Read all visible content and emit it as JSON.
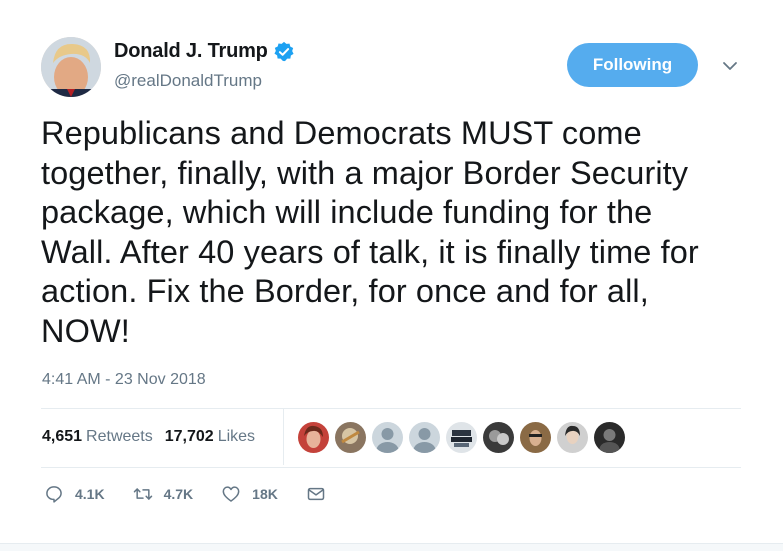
{
  "author": {
    "display_name": "Donald J. Trump",
    "handle": "@realDonaldTrump",
    "verified": true,
    "verified_icon": "verified-badge-icon",
    "verified_color": "#1da1f2"
  },
  "follow_button": {
    "label": "Following",
    "color": "#55acee"
  },
  "menu_icon": "chevron-down-icon",
  "tweet": {
    "text": "Republicans and Democrats MUST come\ntogether, finally, with a major Border Security\npackage, which will include funding for the\nWall. After 40 years of talk, it is finally time for\naction. Fix the Border, for once and for all,\nNOW!",
    "timestamp": "4:41 AM - 23 Nov 2018"
  },
  "stats": {
    "retweets_count": "4,651",
    "retweets_label": "Retweets",
    "likes_count": "17,702",
    "likes_label": "Likes"
  },
  "likers": [
    "liker-avatar-1",
    "liker-avatar-2",
    "liker-avatar-3",
    "liker-avatar-4",
    "liker-avatar-5",
    "liker-avatar-6",
    "liker-avatar-7",
    "liker-avatar-8",
    "liker-avatar-9"
  ],
  "actions": {
    "reply": {
      "icon": "reply-icon",
      "count": "4.1K"
    },
    "retweet": {
      "icon": "retweet-icon",
      "count": "4.7K"
    },
    "like": {
      "icon": "heart-icon",
      "count": "18K"
    },
    "message": {
      "icon": "envelope-icon"
    }
  },
  "colors": {
    "text": "#14171a",
    "secondary": "#657786",
    "border": "#e6ecf0"
  }
}
